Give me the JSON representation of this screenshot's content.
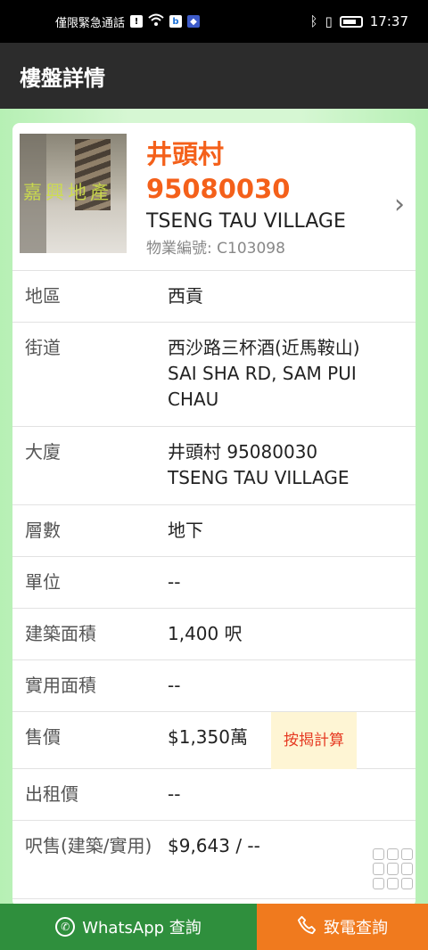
{
  "status_bar": {
    "carrier": "僅限緊急通話",
    "time": "17:37"
  },
  "app_bar": {
    "title": "樓盤詳情"
  },
  "listing": {
    "watermark": "嘉興地產",
    "name_cn": "井頭村",
    "number": "95080030",
    "name_en": "TSENG TAU VILLAGE",
    "ref": "物業編號: C103098"
  },
  "rows": [
    {
      "label": "地區",
      "value": "西貢"
    },
    {
      "label": "街道",
      "value": "西沙路三杯酒(近馬鞍山)",
      "value2": "SAI SHA RD, SAM PUI CHAU"
    },
    {
      "label": "大廈",
      "value": "井頭村 95080030",
      "value2": "TSENG TAU VILLAGE"
    },
    {
      "label": "層數",
      "value": "地下"
    },
    {
      "label": "單位",
      "value": "--"
    },
    {
      "label": "建築面積",
      "value": "1,400 呎"
    },
    {
      "label": "實用面積",
      "value": "--"
    },
    {
      "label": "售價",
      "value": "$1,350萬",
      "button": "按揭計算"
    },
    {
      "label": "出租價",
      "value": "--"
    },
    {
      "label": "呎售(建築/實用)",
      "value": "$9,643 / --"
    }
  ],
  "bottom": {
    "whatsapp_label": "WhatsApp 查詢",
    "call_label": "致電查詢"
  },
  "colors": {
    "accent": "#f4601a",
    "whatsapp": "#2f8f3d",
    "call": "#f07a1e"
  }
}
